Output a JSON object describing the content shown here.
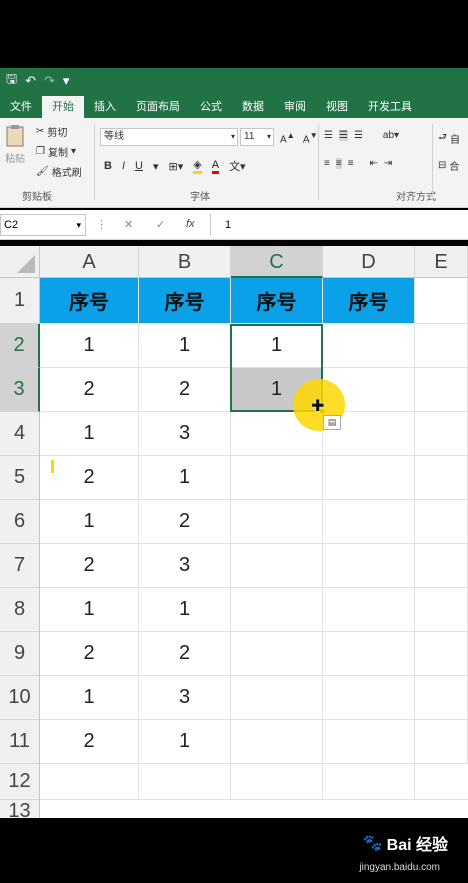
{
  "quick_access": {
    "save": "🖫",
    "undo": "↶",
    "redo": "↷"
  },
  "tabs": [
    "文件",
    "开始",
    "插入",
    "页面布局",
    "公式",
    "数据",
    "审阅",
    "视图",
    "开发工具"
  ],
  "ribbon": {
    "paste": "粘贴",
    "cut": "剪切",
    "copy": "复制",
    "format_painter": "格式刷",
    "clipboard_group": "剪贴板",
    "font_name": "等线",
    "font_size": "11",
    "bold": "B",
    "italic": "I",
    "underline": "U",
    "font_group": "字体",
    "alignment_group": "对齐方式",
    "auto_wrap": "自",
    "merge": "合"
  },
  "formula_bar": {
    "name_box": "C2",
    "cancel": "✕",
    "confirm": "✓",
    "fx": "fx",
    "value": "1"
  },
  "columns": [
    "A",
    "B",
    "C",
    "D",
    "E"
  ],
  "rows": [
    "1",
    "2",
    "3",
    "4",
    "5",
    "6",
    "7",
    "8",
    "9",
    "10",
    "11",
    "12",
    "13"
  ],
  "cells": {
    "header_row": [
      "序号",
      "序号",
      "序号",
      "序号"
    ],
    "col_a": [
      "1",
      "2",
      "1",
      "2",
      "1",
      "2",
      "1",
      "2",
      "1",
      "2"
    ],
    "col_b": [
      "1",
      "2",
      "3",
      "1",
      "2",
      "3",
      "1",
      "2",
      "3",
      "1"
    ],
    "col_c": [
      "1",
      "1"
    ]
  },
  "colors": {
    "excel_green": "#217346",
    "header_fill": "#0aa1e8",
    "cursor": "#ffd700"
  },
  "watermark": {
    "brand": "Bai 经验",
    "url": "jingyan.baidu.com"
  }
}
